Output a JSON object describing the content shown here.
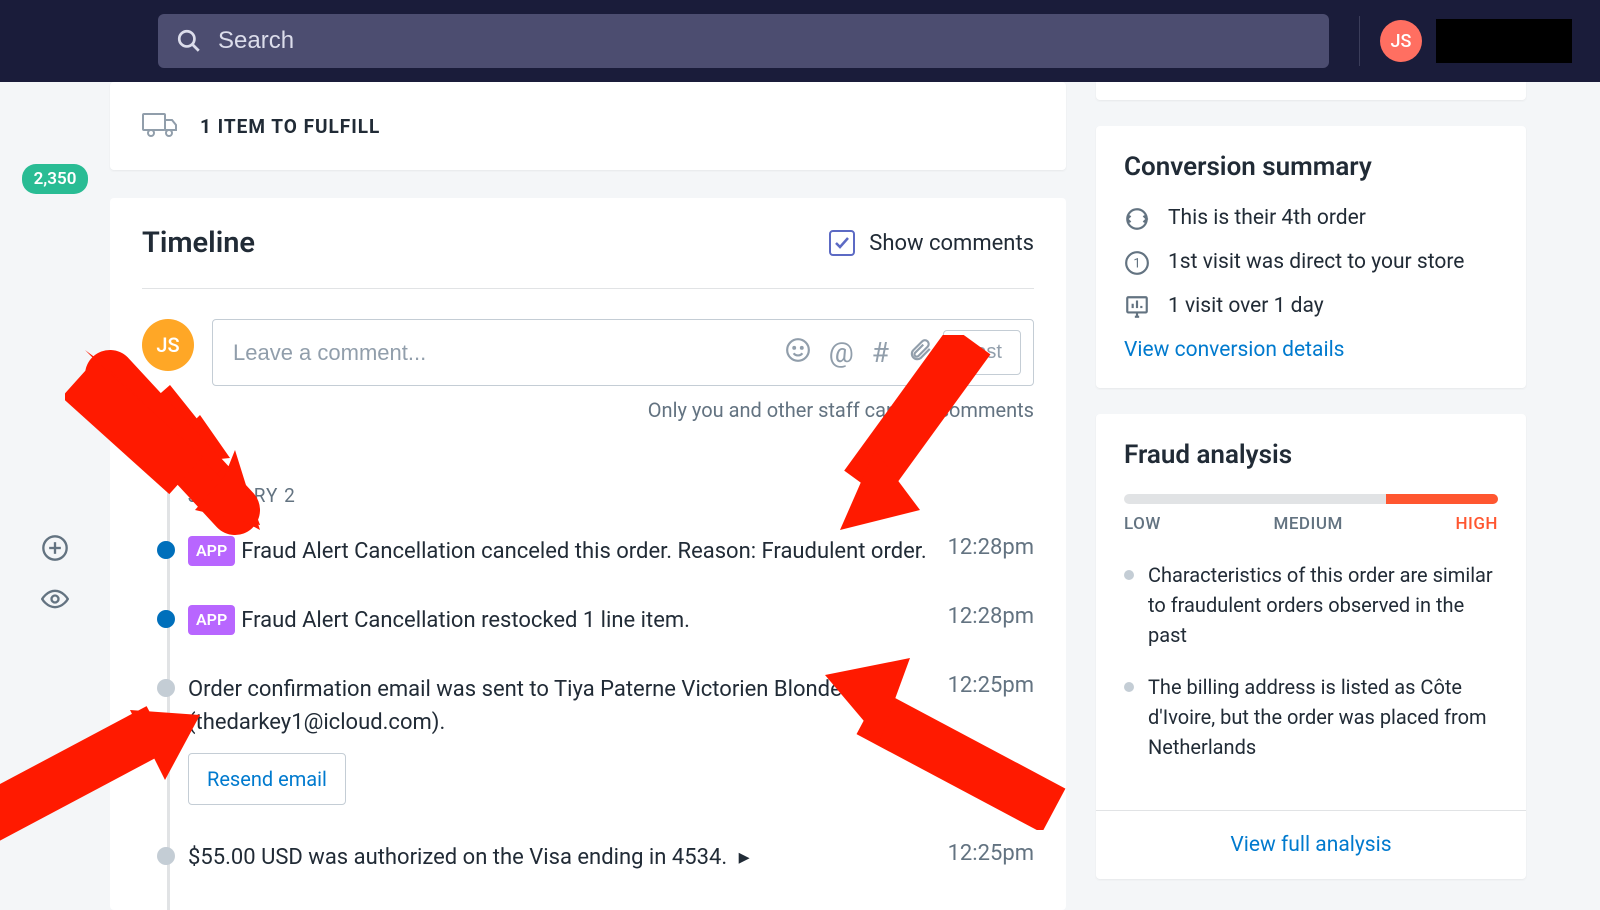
{
  "topbar": {
    "search_placeholder": "Search",
    "avatar_initials": "JS"
  },
  "leftrail": {
    "badge": "2,350"
  },
  "fulfill": {
    "label": "1 ITEM TO FULFILL"
  },
  "timeline": {
    "title": "Timeline",
    "show_comments": "Show comments",
    "comment_placeholder": "Leave a comment...",
    "post_label": "Post",
    "note": "Only you and other staff can see comments",
    "avatar_initials": "JS",
    "date": "JANUARY 2",
    "app_tag": "APP",
    "resend_label": "Resend email",
    "items": [
      {
        "app": true,
        "text": "Fraud Alert Cancellation canceled this order. Reason: Fraudulent order.",
        "time": "12:28pm",
        "dot": "blue"
      },
      {
        "app": true,
        "text": "Fraud Alert Cancellation restocked 1 line item.",
        "time": "12:28pm",
        "dot": "blue"
      },
      {
        "app": false,
        "text": "Order confirmation email was sent to Tiya Paterne Victorien Blondé (thedarkey1@icloud.com).",
        "time": "12:25pm",
        "dot": "grey",
        "resend": true
      },
      {
        "app": false,
        "text": "$55.00 USD was authorized on the Visa ending in 4534.",
        "time": "12:25pm",
        "dot": "grey",
        "caret": true
      }
    ]
  },
  "conversion": {
    "title": "Conversion summary",
    "items": [
      "This is their 4th order",
      "1st visit was direct to your store",
      "1 visit over 1 day"
    ],
    "link": "View conversion details"
  },
  "fraud": {
    "title": "Fraud analysis",
    "low": "LOW",
    "medium": "MEDIUM",
    "high": "HIGH",
    "bullets": [
      "Characteristics of this order are similar to fraudulent orders observed in the past",
      "The billing address is listed as Côte d'Ivoire, but the order was placed from Netherlands"
    ],
    "link": "View full analysis"
  }
}
